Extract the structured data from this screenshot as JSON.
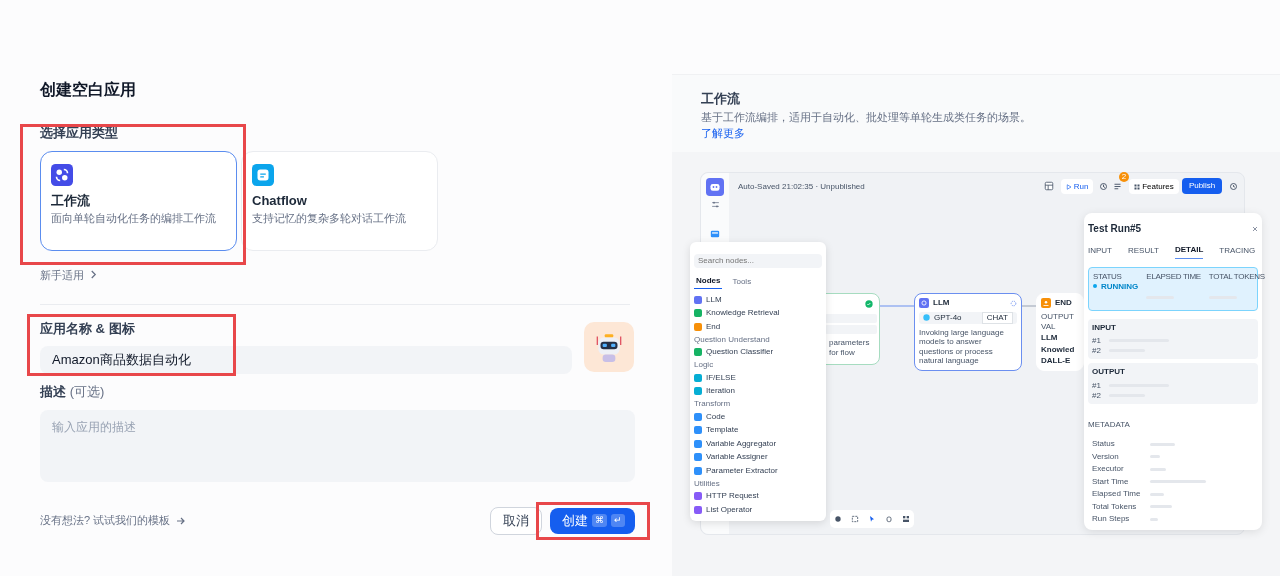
{
  "title": "创建空白应用",
  "app_type": {
    "label": "选择应用类型",
    "options": [
      {
        "kind": "workflow",
        "name": "工作流",
        "description": "面向单轮自动化任务的编排工作流",
        "selected": true
      },
      {
        "kind": "chatflow",
        "name": "Chatflow",
        "description": "支持记忆的复杂多轮对话工作流",
        "selected": false
      }
    ],
    "beginner_link": "新手适用"
  },
  "name_field": {
    "label": "应用名称 & 图标",
    "value": "Amazon商品数据自动化"
  },
  "description_field": {
    "label": "描述",
    "optional": "(可选)",
    "placeholder": "输入应用的描述"
  },
  "template_link": "没有想法? 试试我们的模板",
  "buttons": [
    {
      "kind": "cancel",
      "label": "取消"
    },
    {
      "kind": "create",
      "label": "创建",
      "shortcut": [
        "⌘",
        "↵"
      ]
    }
  ],
  "preview": {
    "title": "工作流",
    "description": "基于工作流编排，适用于自动化、批处理等单轮生成类任务的场景。",
    "link": "了解更多",
    "editor": {
      "status": "Auto-Saved 21:02:35 · Unpublished",
      "run": "Run",
      "badge": "2",
      "features": "Features",
      "publish": "Publish",
      "node_panel": {
        "placeholder": "Search nodes...",
        "tabs": [
          {
            "label": "Nodes",
            "selected": true
          },
          {
            "label": "Tools",
            "selected": false
          }
        ],
        "groups": [
          {
            "items": [
              {
                "label": "LLM",
                "color": "#6172f3"
              },
              {
                "label": "Knowledge Retrieval",
                "color": "#16b364"
              },
              {
                "label": "End",
                "color": "#f79009"
              }
            ]
          },
          {
            "title": "Question Understand",
            "items": [
              {
                "label": "Question Classifier",
                "color": "#16b364"
              }
            ]
          },
          {
            "title": "Logic",
            "items": [
              {
                "label": "IF/ELSE",
                "color": "#06aed4"
              },
              {
                "label": "Iteration",
                "color": "#06aed4"
              }
            ]
          },
          {
            "title": "Transform",
            "items": [
              {
                "label": "Code",
                "color": "#2e90fa"
              },
              {
                "label": "Template",
                "color": "#2e90fa"
              },
              {
                "label": "Variable Aggregator",
                "color": "#2e90fa"
              },
              {
                "label": "Variable Assigner",
                "color": "#2e90fa"
              },
              {
                "label": "Parameter Extractor",
                "color": "#2e90fa"
              }
            ]
          },
          {
            "title": "Utilities",
            "items": [
              {
                "label": "HTTP Request",
                "color": "#875bf7"
              },
              {
                "label": "List Operator",
                "color": "#875bf7"
              }
            ]
          }
        ]
      },
      "start_node": {
        "description": "parameters for flow"
      },
      "llm_node": {
        "title": "LLM",
        "model": "GPT-4o",
        "mode": "CHAT",
        "description": "Invoking large language models to answer questions or process natural language"
      },
      "end_node": {
        "title": "END",
        "output_label": "OUTPUT VAL",
        "outputs": [
          "LLM",
          "Knowled",
          "DALL-E"
        ]
      },
      "test_run": {
        "title": "Test Run#5",
        "tabs": [
          {
            "label": "INPUT",
            "selected": false
          },
          {
            "label": "RESULT",
            "selected": false
          },
          {
            "label": "DETAIL",
            "selected": true
          },
          {
            "label": "TRACING",
            "selected": false
          }
        ],
        "status_labels": [
          "STATUS",
          "ELAPSED TIME",
          "TOTAL TOKENS"
        ],
        "status": "RUNNING",
        "sections": [
          {
            "title": "INPUT",
            "rows": [
              "#1",
              "#2"
            ]
          },
          {
            "title": "OUTPUT",
            "rows": [
              "#1",
              "#2"
            ]
          }
        ],
        "metadata_title": "METADATA",
        "metadata": [
          "Status",
          "Version",
          "Executor",
          "Start Time",
          "Elapsed Time",
          "Total Tokens",
          "Run Steps"
        ]
      }
    }
  }
}
